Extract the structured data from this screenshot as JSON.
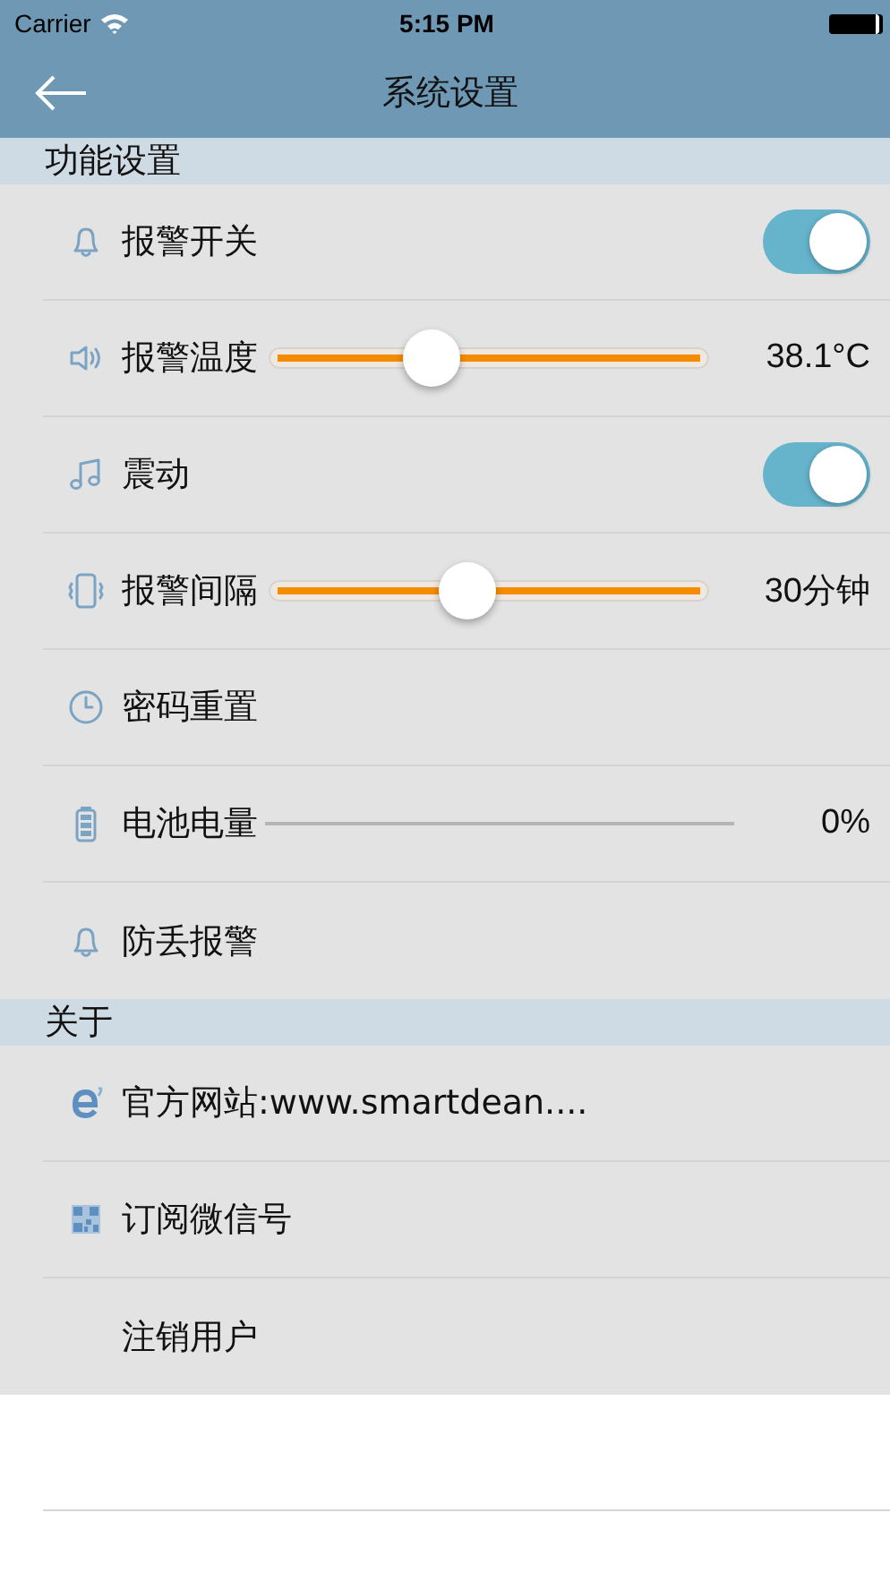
{
  "status_bar": {
    "carrier": "Carrier",
    "time": "5:15 PM"
  },
  "nav_bar": {
    "title": "系统设置"
  },
  "sections": [
    {
      "title": "功能设置",
      "items": [
        {
          "kind": "switch",
          "label": "报警开关",
          "on": true
        },
        {
          "kind": "slider",
          "label": "报警温度",
          "level": 0.37,
          "reading": "38.1°C"
        },
        {
          "kind": "switch",
          "label": "震动",
          "on": true
        },
        {
          "kind": "slider",
          "label": "报警间隔",
          "level": 0.45,
          "reading": "30分钟"
        },
        {
          "kind": "plain",
          "label": "密码重置"
        },
        {
          "kind": "progress",
          "label": "电池电量",
          "level": 0,
          "reading": "0%"
        },
        {
          "kind": "plain",
          "label": "防丢报警"
        }
      ]
    },
    {
      "title": "关于",
      "items": [
        {
          "kind": "plain",
          "label": "官方网站:www.smartdean...."
        },
        {
          "kind": "plain",
          "label": "订阅微信号"
        },
        {
          "kind": "plain",
          "label": "注销用户"
        }
      ]
    }
  ]
}
